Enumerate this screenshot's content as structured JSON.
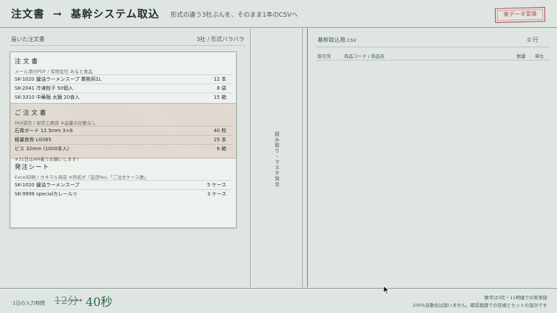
{
  "header": {
    "title": "注文書",
    "arrow": "→",
    "title2": "基幹システム取込",
    "subtitle": "形式の違う3社ぶんを、そのまま1本のCSVへ",
    "stamp": "実データ変換"
  },
  "left": {
    "heading": "届いた注文書",
    "heading_right": "3社 / 形式バラバラ",
    "docs": [
      {
        "title": "注文書",
        "meta": "メール添付PDF / 有限会社 みなと食品",
        "rows": [
          {
            "item": "SK-1020 醤油ラーメンスープ 業務用1L",
            "qty": "12 本"
          },
          {
            "item": "SK-2041 冷凍餃子 50個入",
            "qty": "8 袋"
          },
          {
            "item": "SK-3310 中華麺 太麺 20食入",
            "qty": "15 箱"
          }
        ]
      },
      {
        "title": "ご注文書",
        "meta": "FAX受信 / 栄空工務店 ※品番の記載なし",
        "rows": [
          {
            "item": "石膏ボード 12.5mm 3×6",
            "qty": "40 枚"
          },
          {
            "item": "軽量鉄骨 LGS65",
            "qty": "25 本"
          },
          {
            "item": "ビス 32mm (1000本入)",
            "qty": "6 箱"
          }
        ],
        "note": "※31日はAM着でお願いします！"
      },
      {
        "title": "発注シート",
        "meta": "Excel印刷 / カネマル商店 ※列名が「品目No」「ご注文ケース数」",
        "rows": [
          {
            "item": "SK-1020 醤油ラーメンスープ",
            "qty": "5 ケース"
          },
          {
            "item": "SK-9999 specialカレールゥ",
            "qty": "3 ケース"
          }
        ]
      }
    ]
  },
  "middle": {
    "vertical_label": "読み取り・マスタ突合"
  },
  "right": {
    "filename": "基幹取込用.csv",
    "count": "0 行",
    "columns": [
      "取引先",
      "商品コード / 商品名",
      "数量",
      "単位"
    ]
  },
  "footer": {
    "label": "1日の入力時間",
    "old": "12分",
    "arrow": "→",
    "new": "40秒",
    "note1": "数字は3社・11明細での実測値",
    "note2": "100%自動化は謳いません。確認画面での目視とセットの設計です"
  },
  "colors": {
    "background": "#dfe6e1",
    "stamp_red": "#a5454a",
    "accent_green": "#2f6a4f",
    "divider_red": "#b55a5e"
  }
}
